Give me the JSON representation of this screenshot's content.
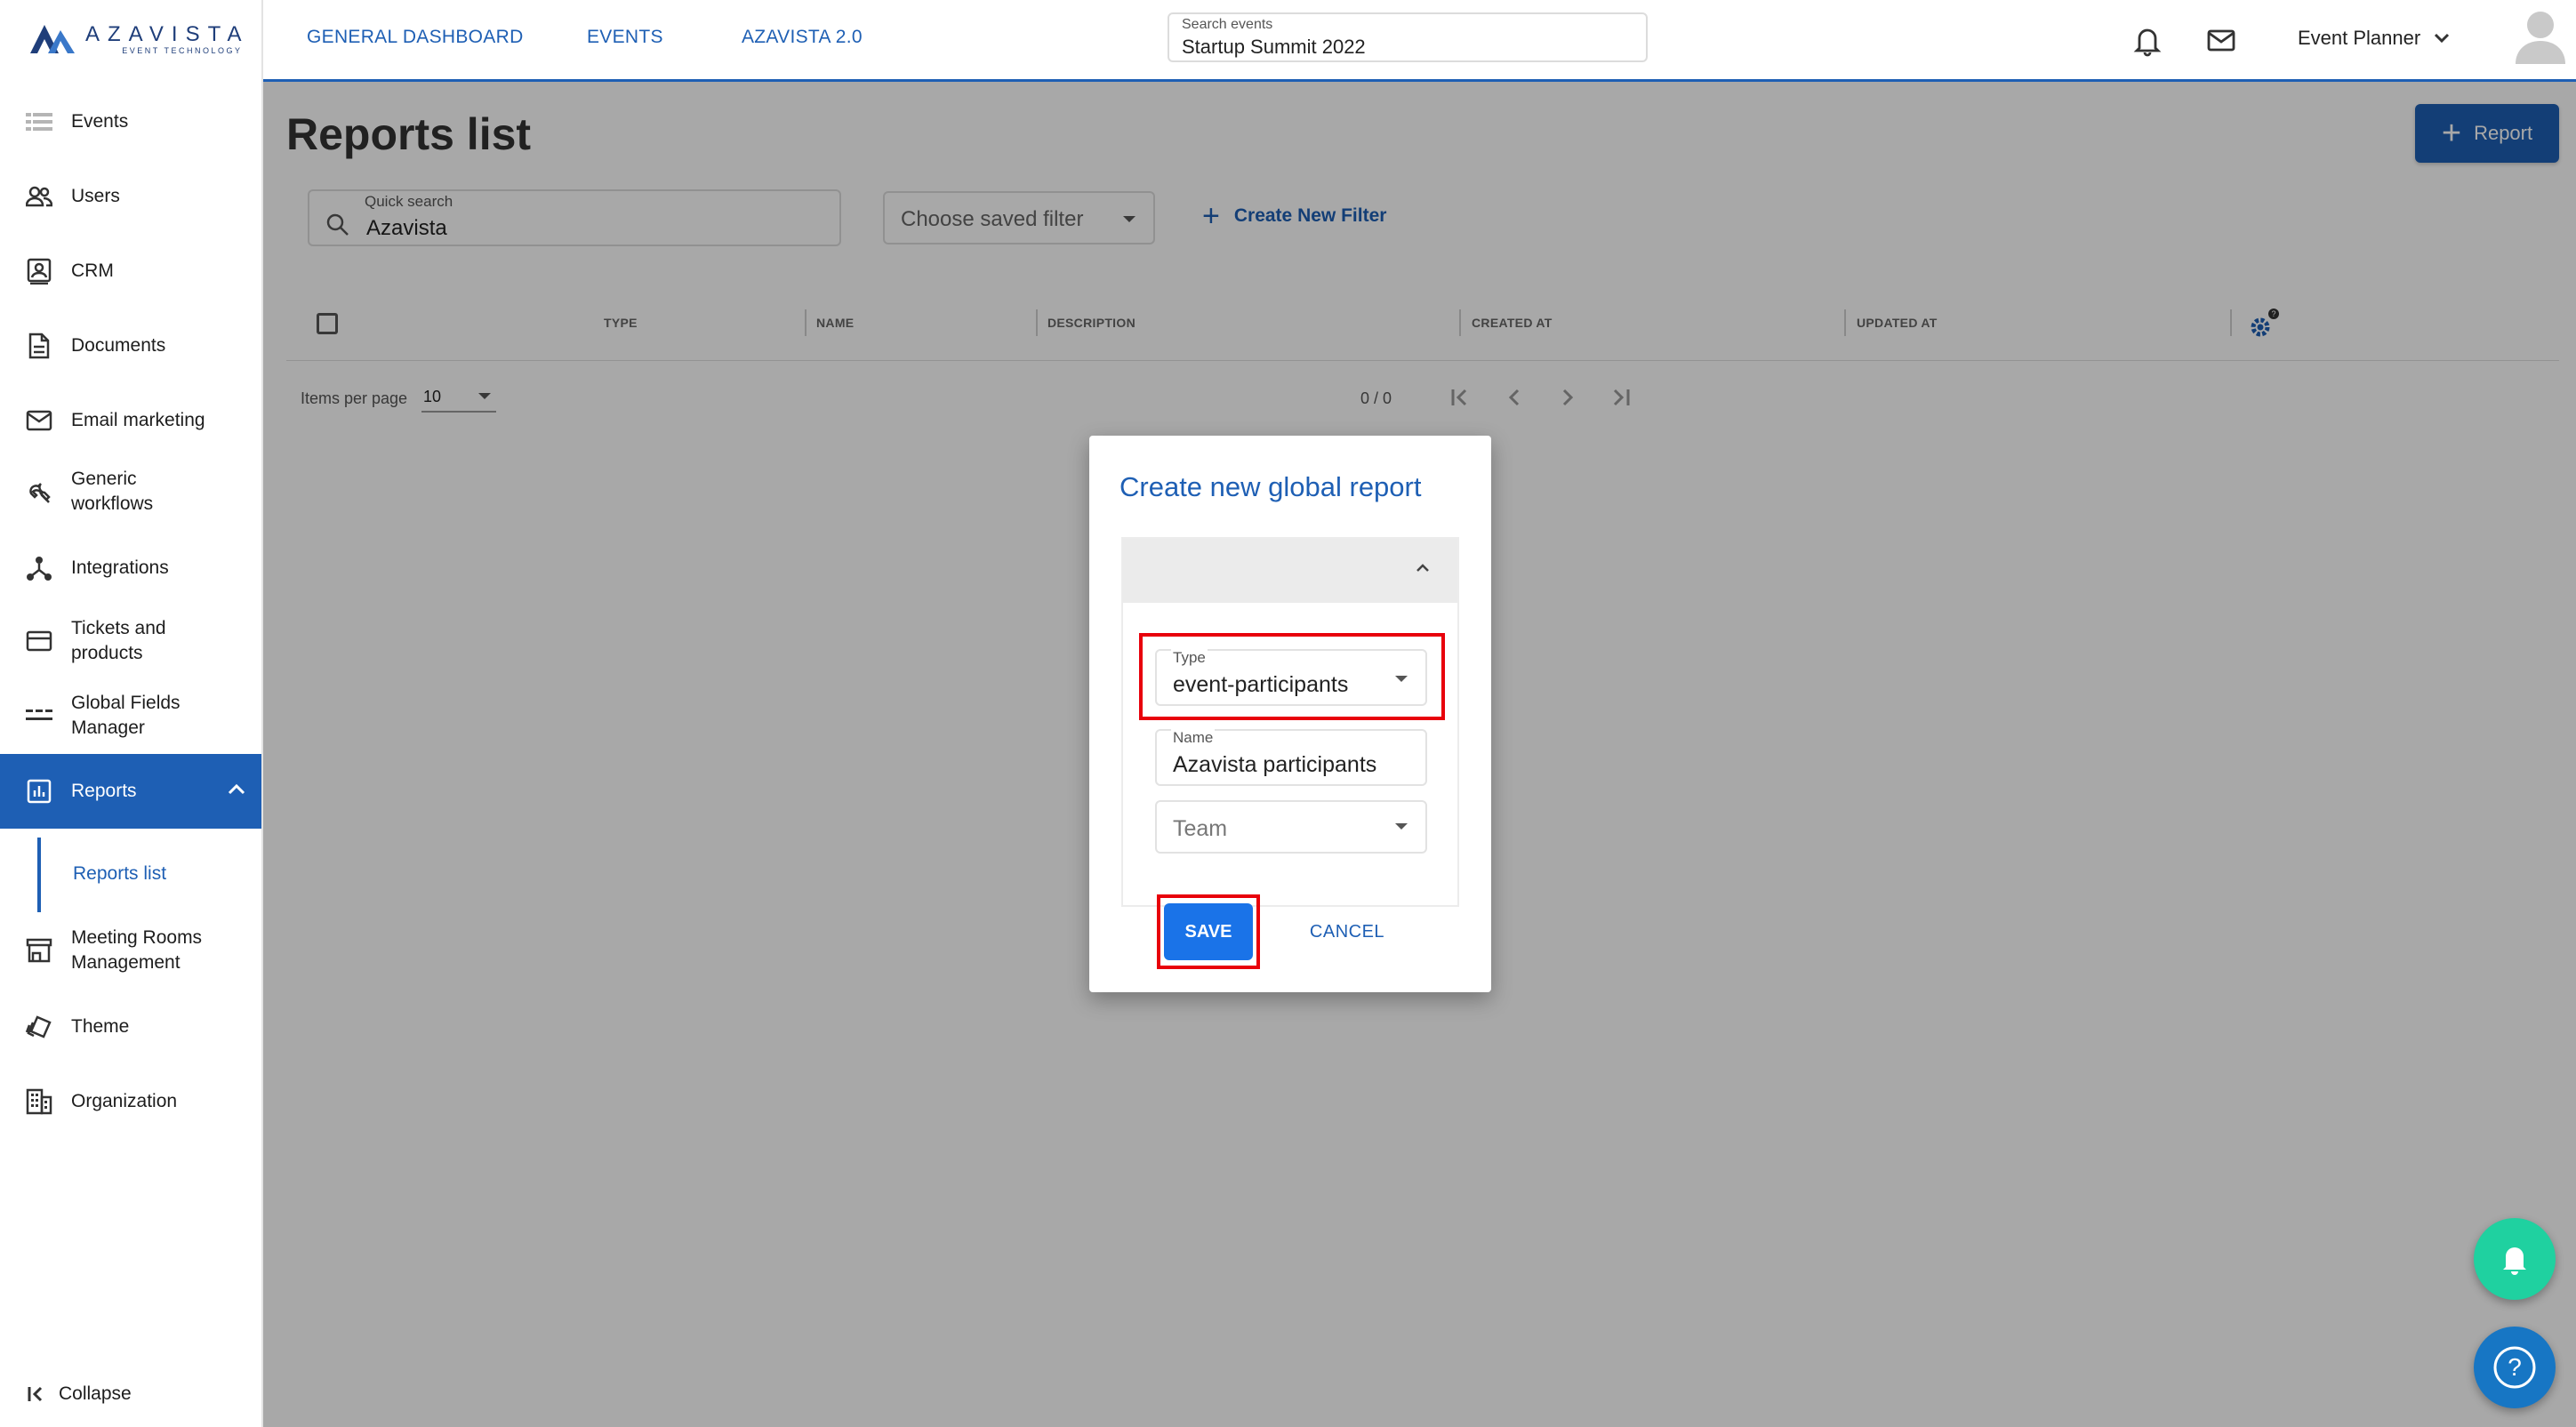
{
  "brand": {
    "word": "AZAVISTA",
    "tagline": "EVENT TECHNOLOGY",
    "color": "#1f3e7a"
  },
  "header": {
    "tabs": [
      {
        "label": "GENERAL DASHBOARD"
      },
      {
        "label": "EVENTS"
      },
      {
        "label": "AZAVISTA 2.0"
      }
    ],
    "search": {
      "label": "Search events",
      "value": "Startup Summit 2022"
    },
    "user": {
      "name": "Event Planner"
    },
    "icons": [
      "bell-icon",
      "mail-icon",
      "chevron-down-icon",
      "user-avatar-icon"
    ]
  },
  "sidebar": {
    "items": [
      {
        "label": "Events",
        "icon": "events-icon"
      },
      {
        "label": "Users",
        "icon": "users-icon"
      },
      {
        "label": "CRM",
        "icon": "crm-icon"
      },
      {
        "label": "Documents",
        "icon": "document-icon"
      },
      {
        "label": "Email marketing",
        "icon": "mail-icon"
      },
      {
        "label": "Generic\nworkflows",
        "icon": "wrench-icon"
      },
      {
        "label": "Integrations",
        "icon": "integrations-icon"
      },
      {
        "label": "Tickets and\nproducts",
        "icon": "ticket-icon"
      },
      {
        "label": "Global Fields\nManager",
        "icon": "fields-icon"
      },
      {
        "label": "Reports",
        "icon": "chart-icon",
        "active": true
      },
      {
        "label": "Meeting Rooms\nManagement",
        "icon": "store-icon"
      },
      {
        "label": "Theme",
        "icon": "theme-icon"
      },
      {
        "label": "Organization",
        "icon": "building-icon"
      }
    ],
    "sub_item": "Reports list",
    "collapse": "Collapse"
  },
  "main": {
    "title": "Reports list",
    "add_button": "Report",
    "quick_search": {
      "label": "Quick search",
      "value": "Azavista"
    },
    "saved_filter_placeholder": "Choose saved filter",
    "create_filter": "Create New Filter",
    "table": {
      "columns": [
        "TYPE",
        "NAME",
        "DESCRIPTION",
        "CREATED AT",
        "UPDATED AT"
      ],
      "items_per_page_label": "Items per page",
      "items_per_page": "10",
      "range": "0 / 0"
    }
  },
  "dialog": {
    "title": "Create new global report",
    "type": {
      "label": "Type",
      "value": "event-participants"
    },
    "name": {
      "label": "Name",
      "value": "Azavista participants"
    },
    "team": {
      "placeholder": "Team"
    },
    "save": "SAVE",
    "cancel": "CANCEL"
  },
  "colors": {
    "primary": "#1e5fb4",
    "save": "#1a73e8",
    "highlight": "#e8000b",
    "notify_fab": "#1fd1a0",
    "help_fab": "#1776c4"
  }
}
